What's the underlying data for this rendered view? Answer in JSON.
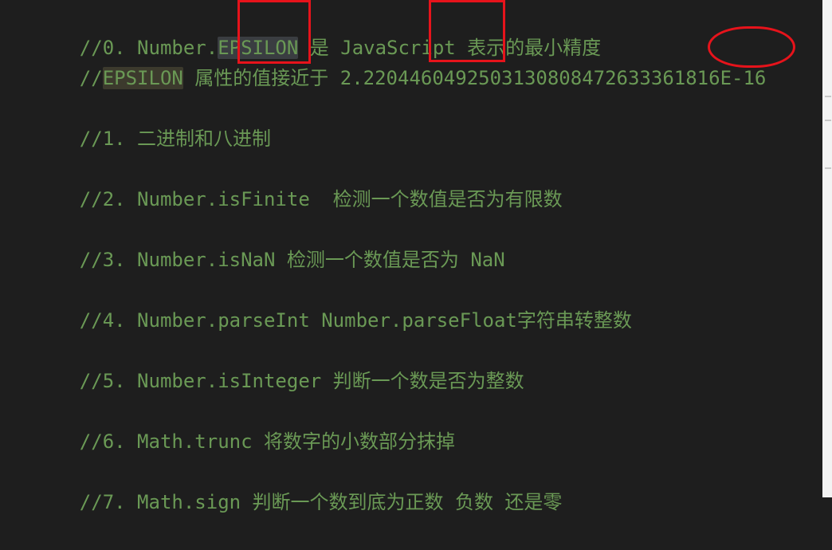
{
  "editor": {
    "lines": [
      {
        "prefix": "//0. Number.",
        "sel": "EPSILON",
        "rest": " 是 JavaScript 表示的最小精度"
      },
      {
        "prefix": "//",
        "occ": "EPSILON",
        "rest": " 属性的值接近于 2.2204460492503130808472633361816E-16"
      },
      {
        "text": "//1. 二进制和八进制"
      },
      {
        "text": "//2. Number.isFinite  检测一个数值是否为有限数"
      },
      {
        "text": "//3. Number.isNaN 检测一个数值是否为 NaN"
      },
      {
        "text": "//4. Number.parseInt Number.parseFloat字符串转整数"
      },
      {
        "text": "//5. Number.isInteger 判断一个数是否为整数"
      },
      {
        "text": "//6. Math.trunc 将数字的小数部分抹掉"
      },
      {
        "text": "//7. Math.sign 判断一个数到底为正数 负数 还是零"
      }
    ]
  },
  "colors": {
    "background": "#1e1e1e",
    "comment": "#6a9955",
    "annotation": "#e6131b"
  }
}
